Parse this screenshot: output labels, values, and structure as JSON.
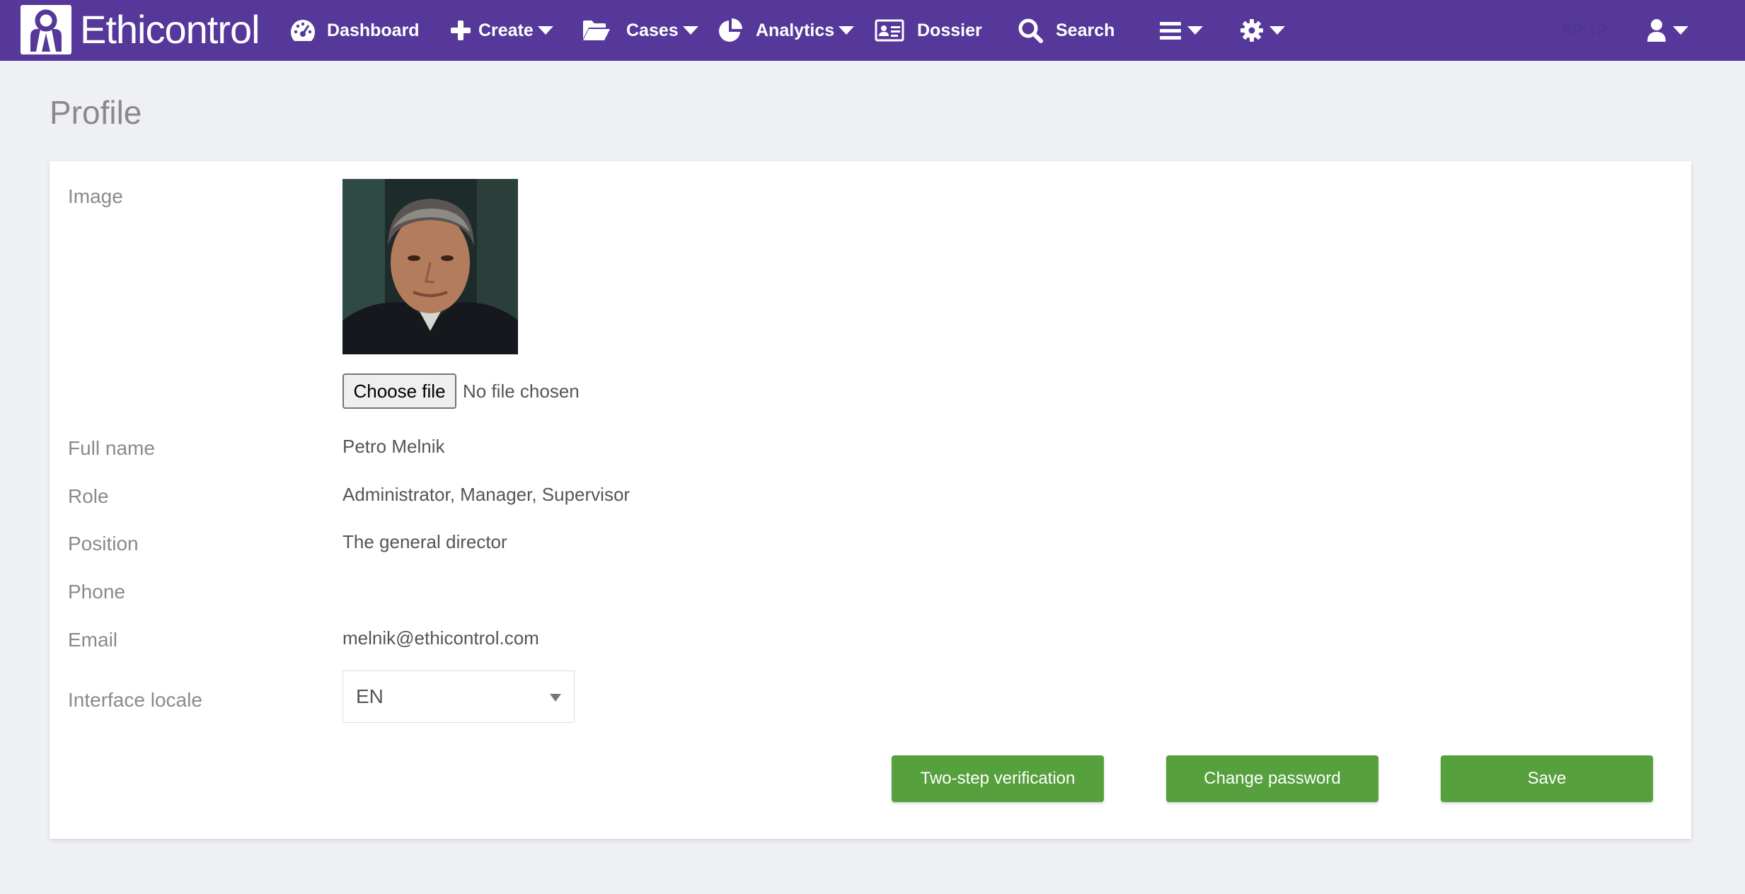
{
  "brand": {
    "name": "Ethicontrol"
  },
  "nav": {
    "dashboard": "Dashboard",
    "create": "Create",
    "cases": "Cases",
    "analytics": "Analytics",
    "dossier": "Dossier",
    "search": "Search",
    "timer": "59:12"
  },
  "page": {
    "title": "Profile"
  },
  "profile": {
    "image_label": "Image",
    "choose_file": "Choose file",
    "file_status": "No file chosen",
    "full_name_label": "Full name",
    "full_name": "Petro Melnik",
    "role_label": "Role",
    "role": "Administrator, Manager, Supervisor",
    "position_label": "Position",
    "position": "The general director",
    "phone_label": "Phone",
    "phone": "",
    "email_label": "Email",
    "email": "melnik@ethicontrol.com",
    "locale_label": "Interface locale",
    "locale_value": "EN"
  },
  "actions": {
    "two_step": "Two-step verification",
    "change_password": "Change password",
    "save": "Save"
  },
  "colors": {
    "navbar": "#55389a",
    "button_green": "#56a03d",
    "background": "#eef0f4"
  },
  "icons": {
    "dashboard": "tachometer-icon",
    "create": "plus-icon",
    "cases": "folder-open-icon",
    "analytics": "pie-chart-icon",
    "dossier": "id-card-icon",
    "search": "search-icon",
    "menu": "bars-icon",
    "settings": "gear-icon",
    "user": "user-icon"
  }
}
